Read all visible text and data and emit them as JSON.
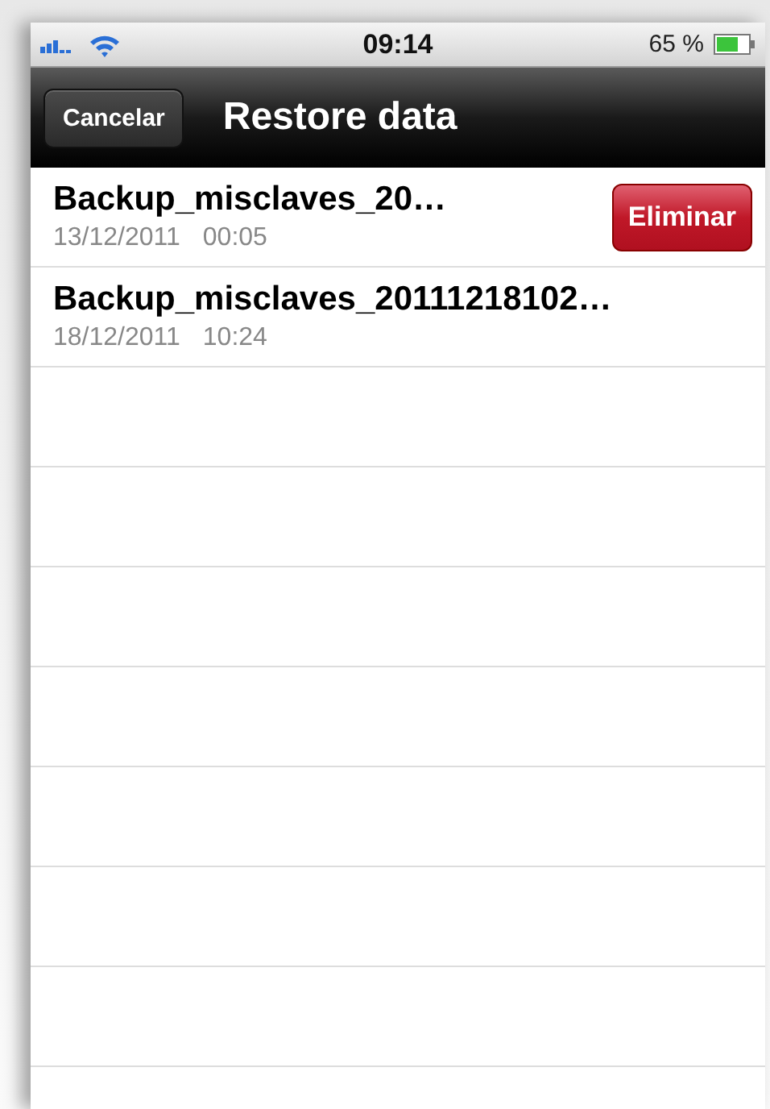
{
  "status_bar": {
    "time": "09:14",
    "battery": "65 %"
  },
  "nav_bar": {
    "back_button": "Cancelar",
    "title": "Restore data"
  },
  "rows": [
    {
      "title": "Backup_misclaves_20…",
      "date": "13/12/2011",
      "time": "00:05",
      "delete_button": "Eliminar"
    },
    {
      "title": "Backup_misclaves_20111218102…",
      "date": "18/12/2011",
      "time": "10:24"
    }
  ]
}
